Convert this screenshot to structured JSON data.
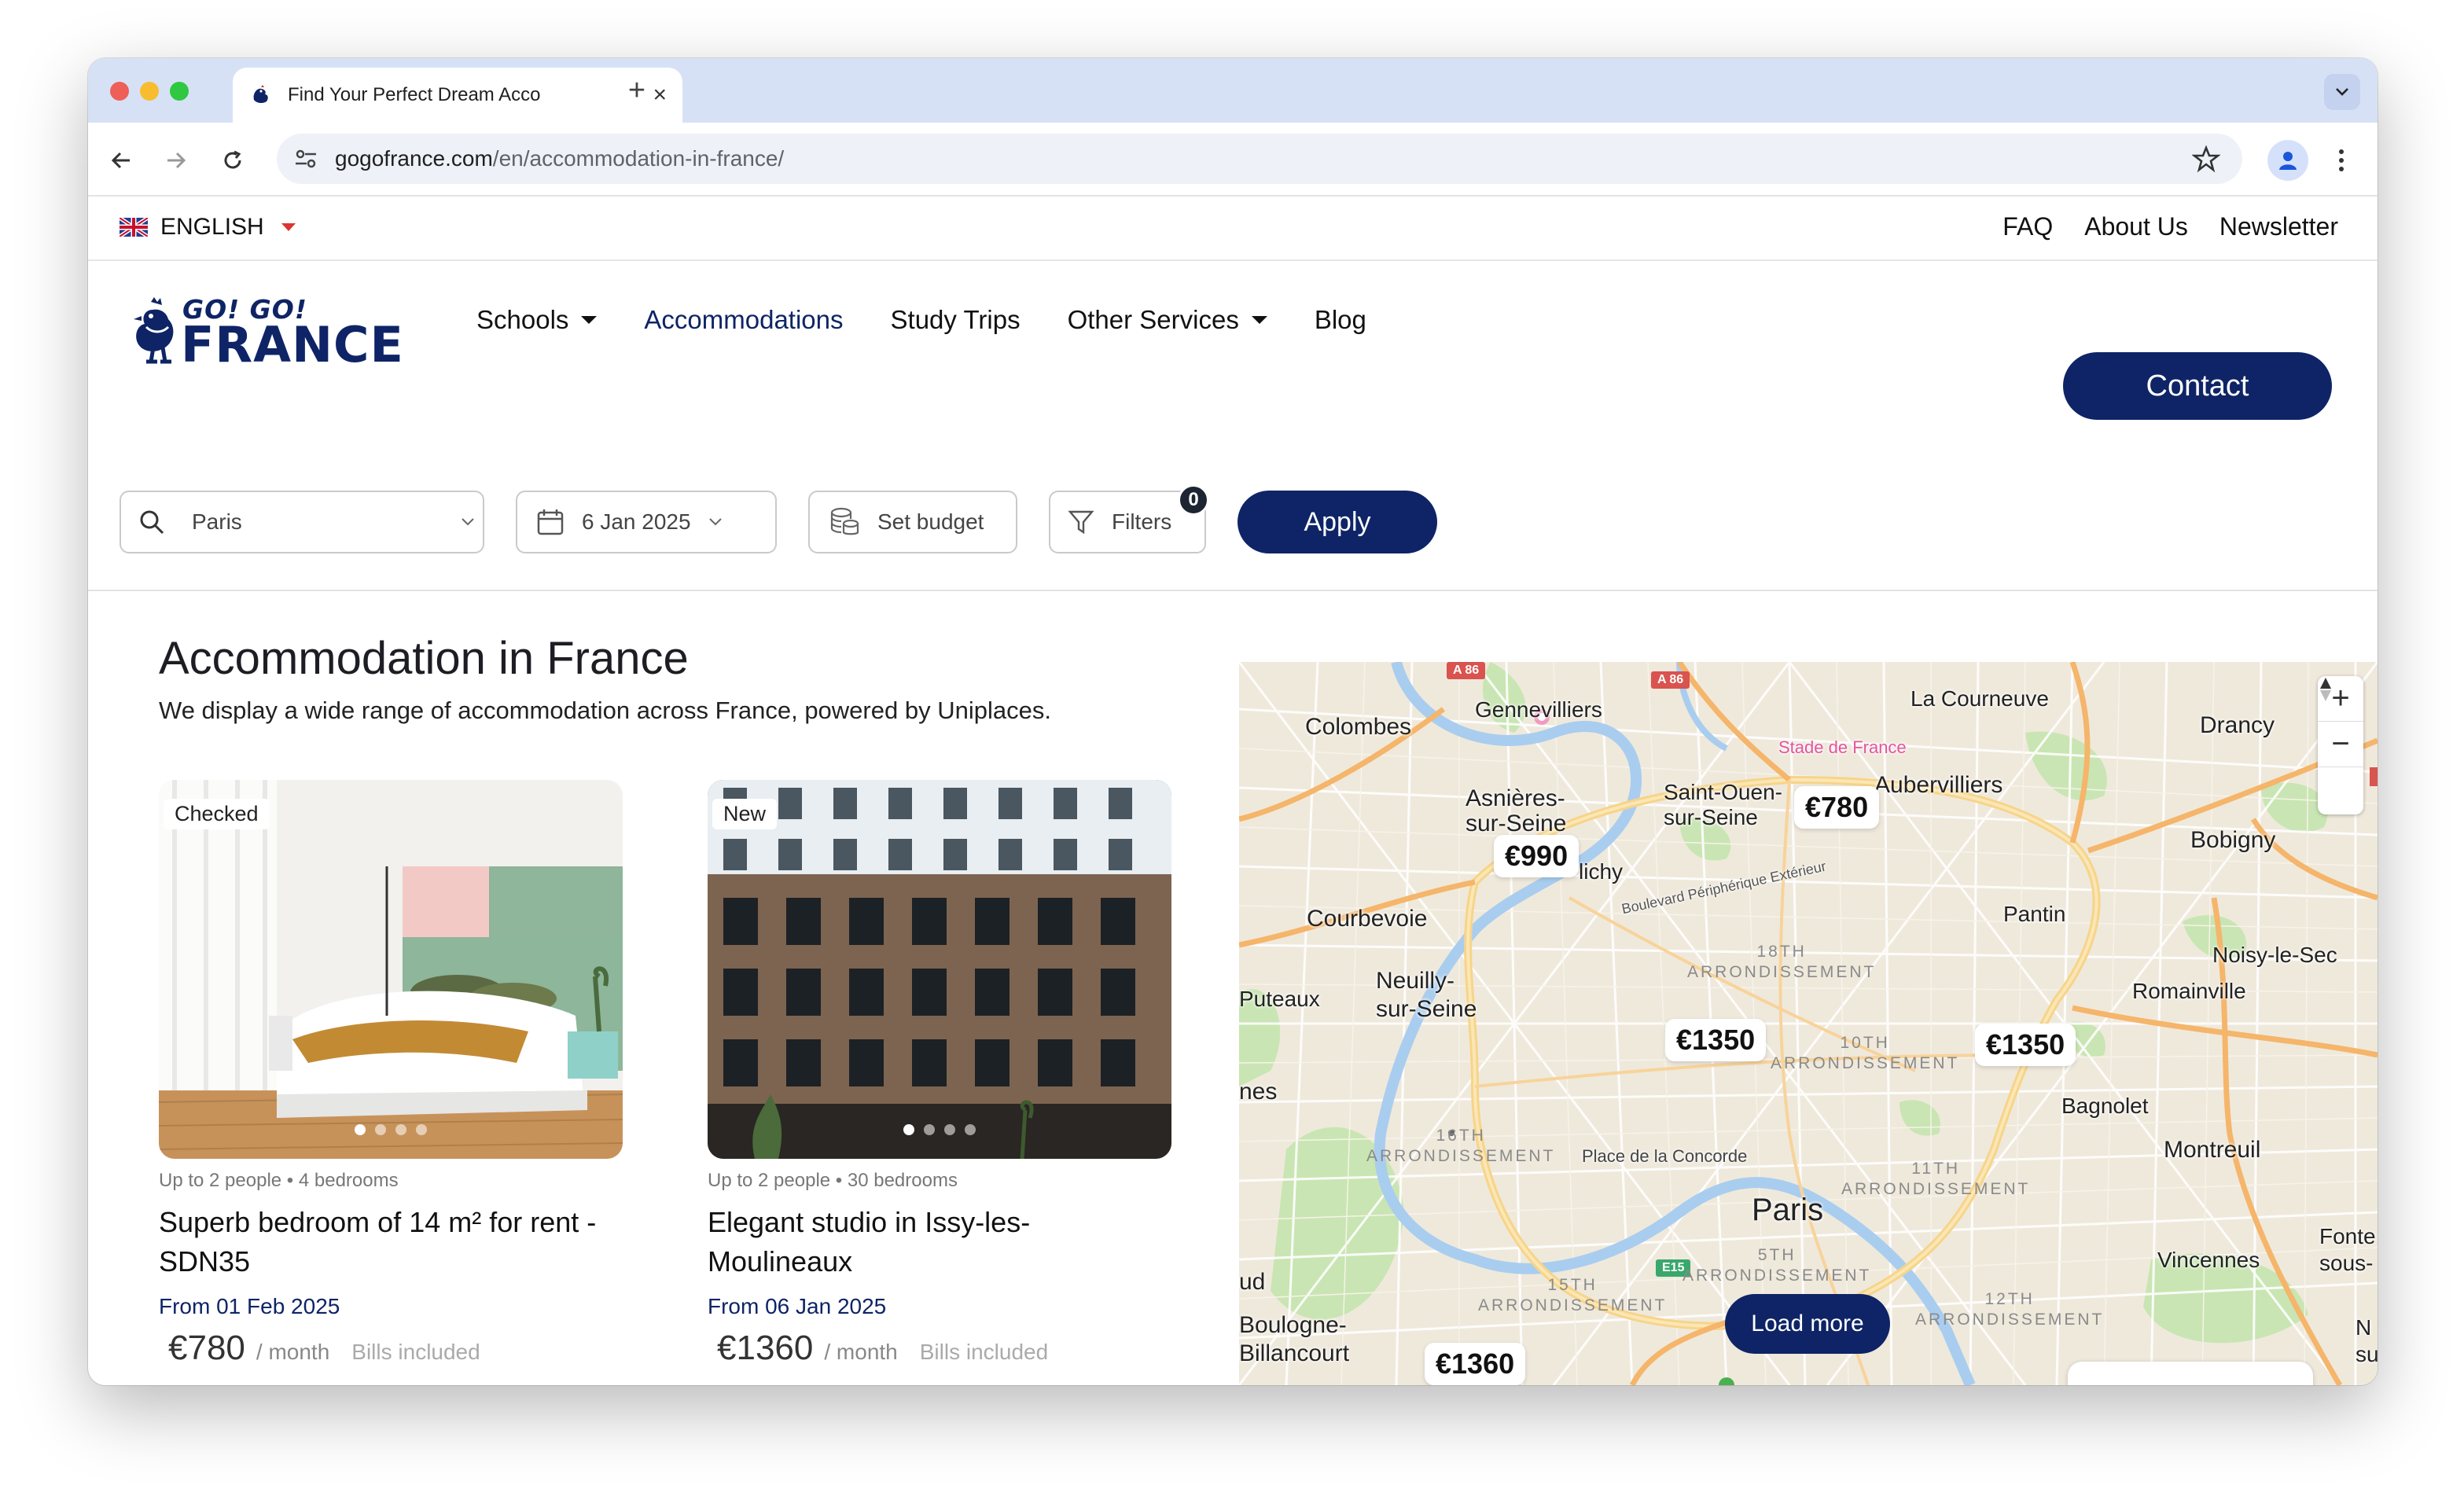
{
  "browser": {
    "tab_title": "Find Your Perfect Dream Acco",
    "url_domain": "gogofrance.com",
    "url_path": "/en/accommodation-in-france/"
  },
  "topbar": {
    "language": "ENGLISH",
    "links": [
      "FAQ",
      "About Us",
      "Newsletter"
    ]
  },
  "header": {
    "logo_line1": "GO! GO!",
    "logo_line2": "FRANCE",
    "nav": [
      "Schools",
      "Accommodations",
      "Study Trips",
      "Other Services",
      "Blog"
    ],
    "active_nav": "Accommodations",
    "contact_label": "Contact"
  },
  "search": {
    "location": "Paris",
    "date": "6 Jan 2025",
    "budget_label": "Set budget",
    "filters_label": "Filters",
    "filters_count": "0",
    "apply_label": "Apply"
  },
  "page": {
    "title": "Accommodation in France",
    "subtitle": "We display a wide range of accommodation across France, powered by Uniplaces."
  },
  "listings": [
    {
      "tag": "Checked",
      "meta": "Up to 2 people • 4 bedrooms",
      "title": "Superb bedroom of 14 m² for rent - SDN35",
      "from": "From 01 Feb 2025",
      "price": "€780",
      "per": "/ month",
      "bills": "Bills included"
    },
    {
      "tag": "New",
      "meta": "Up to 2 people • 30 bedrooms",
      "title": "Elegant studio in Issy-les-Moulineaux",
      "from": "From 06 Jan 2025",
      "price": "€1360",
      "per": "/ month",
      "bills": "Bills included"
    }
  ],
  "map": {
    "places": {
      "colombes": "Colombes",
      "gennevilliers": "Gennevilliers",
      "la_courneuve": "La Courneuve",
      "drancy": "Drancy",
      "asnieres": "Asnières-\nsur-Seine",
      "saint_ouen": "Saint-Ouen-\nsur-Seine",
      "aubervilliers": "Aubervilliers",
      "bobigny": "Bobigny",
      "clichy": "lichy",
      "courbevoie": "Courbevoie",
      "pantin": "Pantin",
      "noisy": "Noisy-le-Sec",
      "romainville": "Romainville",
      "puteaux": "Puteaux",
      "neuilly": "Neuilly-\nsur-Seine",
      "nes": "nes",
      "bagnolet": "Bagnolet",
      "montreuil": "Montreuil",
      "paris": "Paris",
      "fonte": "Fonte\nsous-",
      "vincennes": "Vincennes",
      "ud": "ud",
      "boulogne": "Boulogne-\nBillancourt",
      "ne": "N\nsur",
      "stade": "Stade de France",
      "concorde": "Place de la Concorde",
      "peripherique": "Boulevard Périphérique Extérieur"
    },
    "districts": {
      "d18": "18TH\nARRONDISSEMENT",
      "d10": "10TH\nARRONDISSEMENT",
      "d16": "16TH\nARRONDISSEMENT",
      "d11": "11TH\nARRONDISSEMENT",
      "d5": "5TH\nARRONDISSEMENT",
      "d15": "15TH\nARRONDISSEMENT",
      "d12": "12TH\nARRONDISSEMENT"
    },
    "roads": {
      "a86_1": "A 86",
      "a86_2": "A 86",
      "e15": "E15"
    },
    "pins": {
      "p780": "€780",
      "p990": "€990",
      "p1350a": "€1350",
      "p1350b": "€1350",
      "p1360": "€1360"
    },
    "zoom_in": "+",
    "zoom_out": "−",
    "load_more": "Load more"
  },
  "colors": {
    "brand_navy": "#0e2466",
    "map_park": "#c9e5b3",
    "map_water": "#a9cdef",
    "map_road_major": "#f5b56a"
  }
}
